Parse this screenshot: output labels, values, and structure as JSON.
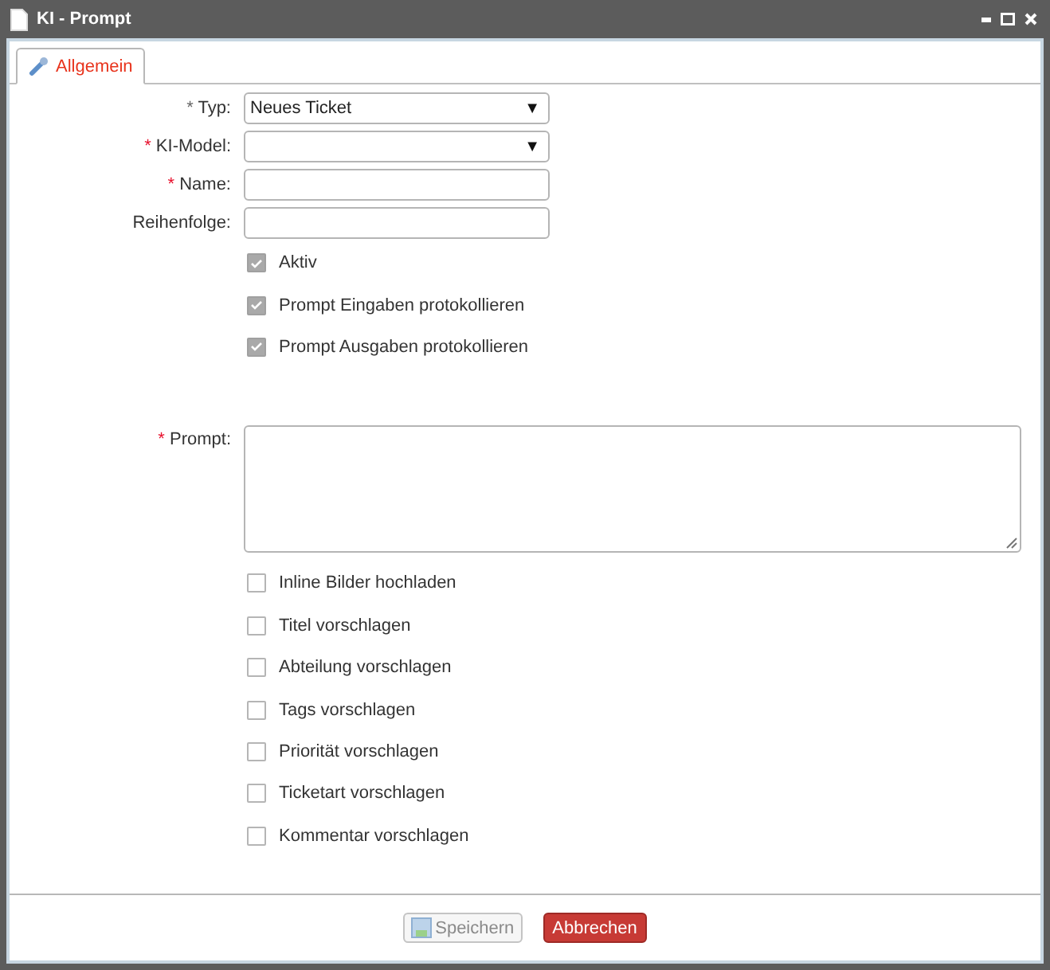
{
  "window": {
    "title": "KI - Prompt"
  },
  "tabs": [
    {
      "label": "Allgemein",
      "selected": true
    }
  ],
  "fields": [
    {
      "kind": "select",
      "label": "Typ:",
      "marker": "*",
      "color": "#666666",
      "value": "Neues Ticket",
      "caret": "▼"
    },
    {
      "kind": "select",
      "label": "KI-Model:",
      "marker": "*",
      "color": "#e8112d",
      "caret": "▼"
    },
    {
      "kind": "text",
      "label": "Name:",
      "marker": "*",
      "color": "#e8112d"
    },
    {
      "kind": "text",
      "label": "Reihenfolge:"
    }
  ],
  "flags": [
    {
      "label": "Aktiv",
      "checked": true,
      "disabled": true
    },
    {
      "label": "Prompt Eingaben protokollieren",
      "checked": true,
      "disabled": true
    },
    {
      "label": "Prompt Ausgaben protokollieren",
      "checked": true,
      "disabled": true
    }
  ],
  "prompt": {
    "label": "Prompt:",
    "marker": "*",
    "color": "#e8112d"
  },
  "options": [
    {
      "label": "Inline Bilder hochladen",
      "checked": false
    },
    {
      "label": "Titel vorschlagen",
      "checked": false
    },
    {
      "label": "Abteilung vorschlagen",
      "checked": false
    },
    {
      "label": "Tags vorschlagen",
      "checked": false
    },
    {
      "label": "Priorität vorschlagen",
      "checked": false
    },
    {
      "label": "Ticketart vorschlagen",
      "checked": false
    },
    {
      "label": "Kommentar vorschlagen",
      "checked": false
    }
  ],
  "buttons": [
    {
      "label": "Speichern",
      "kind": "save",
      "disabled": true
    },
    {
      "label": "Abbrechen",
      "kind": "cancel",
      "disabled": false
    }
  ]
}
